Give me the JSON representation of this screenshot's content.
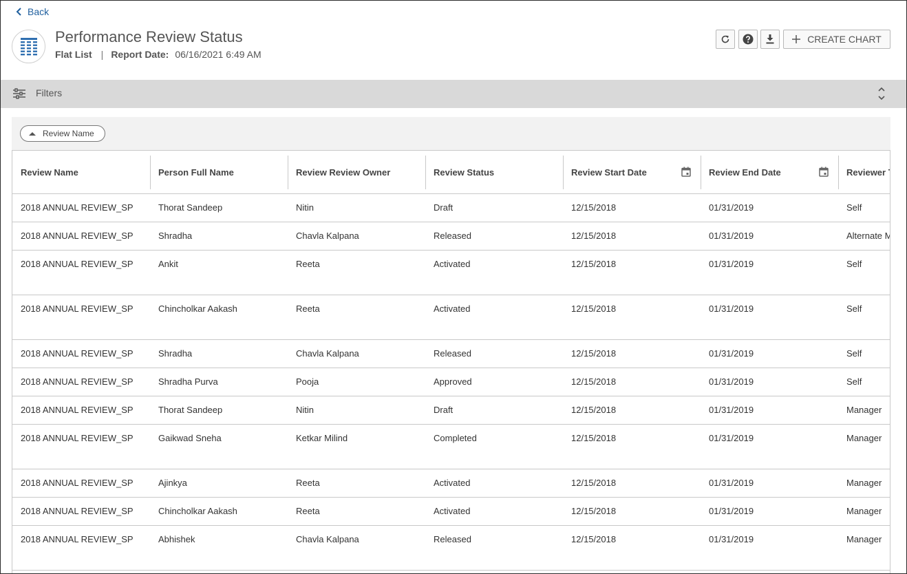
{
  "back_label": "Back",
  "report": {
    "title": "Performance Review Status",
    "view_type": "Flat List",
    "separator": "|",
    "date_label": "Report Date:",
    "date_value": "06/16/2021 6:49 AM",
    "icon": "report-grid-icon"
  },
  "toolbar": {
    "refresh_icon": "refresh-icon",
    "help_icon": "help-icon",
    "download_icon": "download-icon",
    "create_chart_label": "CREATE CHART"
  },
  "filters": {
    "label": "Filters"
  },
  "sort": {
    "chip_label": "Review Name",
    "direction": "ascending"
  },
  "table": {
    "columns": [
      "Review Name",
      "Person Full Name",
      "Review Review Owner",
      "Review Status",
      "Review Start Date",
      "Review End Date",
      "Reviewer T"
    ],
    "rows": [
      {
        "cells": [
          "2018 ANNUAL REVIEW_SP",
          "Thorat Sandeep",
          "Nitin",
          "Draft",
          "12/15/2018",
          "01/31/2019",
          "Self"
        ],
        "tall": false
      },
      {
        "cells": [
          "2018 ANNUAL REVIEW_SP",
          "Shradha",
          "Chavla Kalpana",
          "Released",
          "12/15/2018",
          "01/31/2019",
          "Alternate M"
        ],
        "tall": false
      },
      {
        "cells": [
          "2018 ANNUAL REVIEW_SP",
          "Ankit",
          "Reeta",
          "Activated",
          "12/15/2018",
          "01/31/2019",
          "Self"
        ],
        "tall": true
      },
      {
        "cells": [
          "2018 ANNUAL REVIEW_SP",
          "Chincholkar Aakash",
          "Reeta",
          "Activated",
          "12/15/2018",
          "01/31/2019",
          "Self"
        ],
        "tall": true
      },
      {
        "cells": [
          "2018 ANNUAL REVIEW_SP",
          "Shradha",
          "Chavla Kalpana",
          "Released",
          "12/15/2018",
          "01/31/2019",
          "Self"
        ],
        "tall": false
      },
      {
        "cells": [
          "2018 ANNUAL REVIEW_SP",
          "Shradha Purva",
          "Pooja",
          "Approved",
          "12/15/2018",
          "01/31/2019",
          "Self"
        ],
        "tall": false
      },
      {
        "cells": [
          "2018 ANNUAL REVIEW_SP",
          "Thorat Sandeep",
          "Nitin",
          "Draft",
          "12/15/2018",
          "01/31/2019",
          "Manager"
        ],
        "tall": false
      },
      {
        "cells": [
          "2018 ANNUAL REVIEW_SP",
          "Gaikwad Sneha",
          "Ketkar Milind",
          "Completed",
          "12/15/2018",
          "01/31/2019",
          "Manager"
        ],
        "tall": true
      },
      {
        "cells": [
          "2018 ANNUAL REVIEW_SP",
          "Ajinkya",
          "Reeta",
          "Activated",
          "12/15/2018",
          "01/31/2019",
          "Manager"
        ],
        "tall": false
      },
      {
        "cells": [
          "2018 ANNUAL REVIEW_SP",
          "Chincholkar Aakash",
          "Reeta",
          "Activated",
          "12/15/2018",
          "01/31/2019",
          "Manager"
        ],
        "tall": false
      },
      {
        "cells": [
          "2018 ANNUAL REVIEW_SP",
          "Abhishek",
          "Chavla Kalpana",
          "Released",
          "12/15/2018",
          "01/31/2019",
          "Manager"
        ],
        "tall": true
      }
    ]
  },
  "colors": {
    "link": "#1f5f9e",
    "report_icon": "#2f6fb0",
    "filter_bar": "#d9d9d9",
    "sort_area": "#f2f2f2",
    "border": "#c8c8c8"
  }
}
